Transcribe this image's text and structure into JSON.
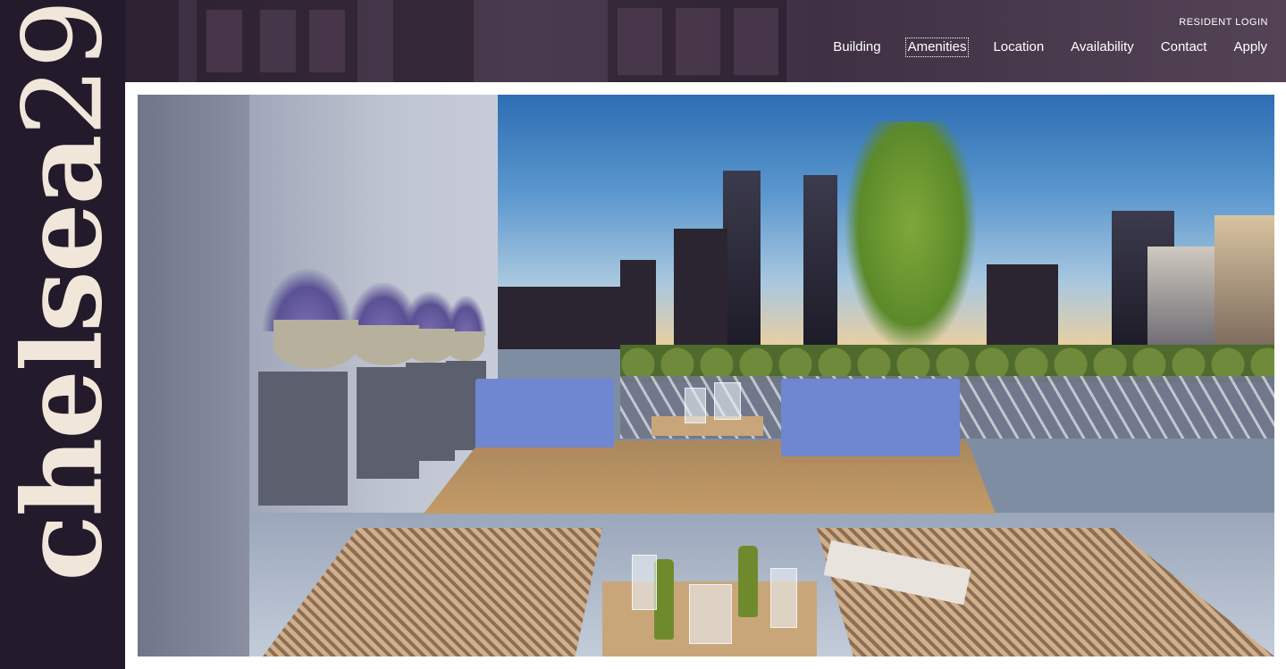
{
  "brand": {
    "logo_text": "chelsea",
    "logo_number": "29",
    "bar_color": "#231a2c",
    "logo_color": "#f1e6da"
  },
  "header": {
    "resident_login": "RESIDENT LOGIN",
    "nav": [
      {
        "label": "Building",
        "active": false
      },
      {
        "label": "Amenities",
        "active": true
      },
      {
        "label": "Location",
        "active": false
      },
      {
        "label": "Availability",
        "active": false
      },
      {
        "label": "Contact",
        "active": false
      },
      {
        "label": "Apply",
        "active": false
      }
    ]
  },
  "hero": {
    "subject": "rooftop terrace lounge photo with city skyline at dusk"
  }
}
